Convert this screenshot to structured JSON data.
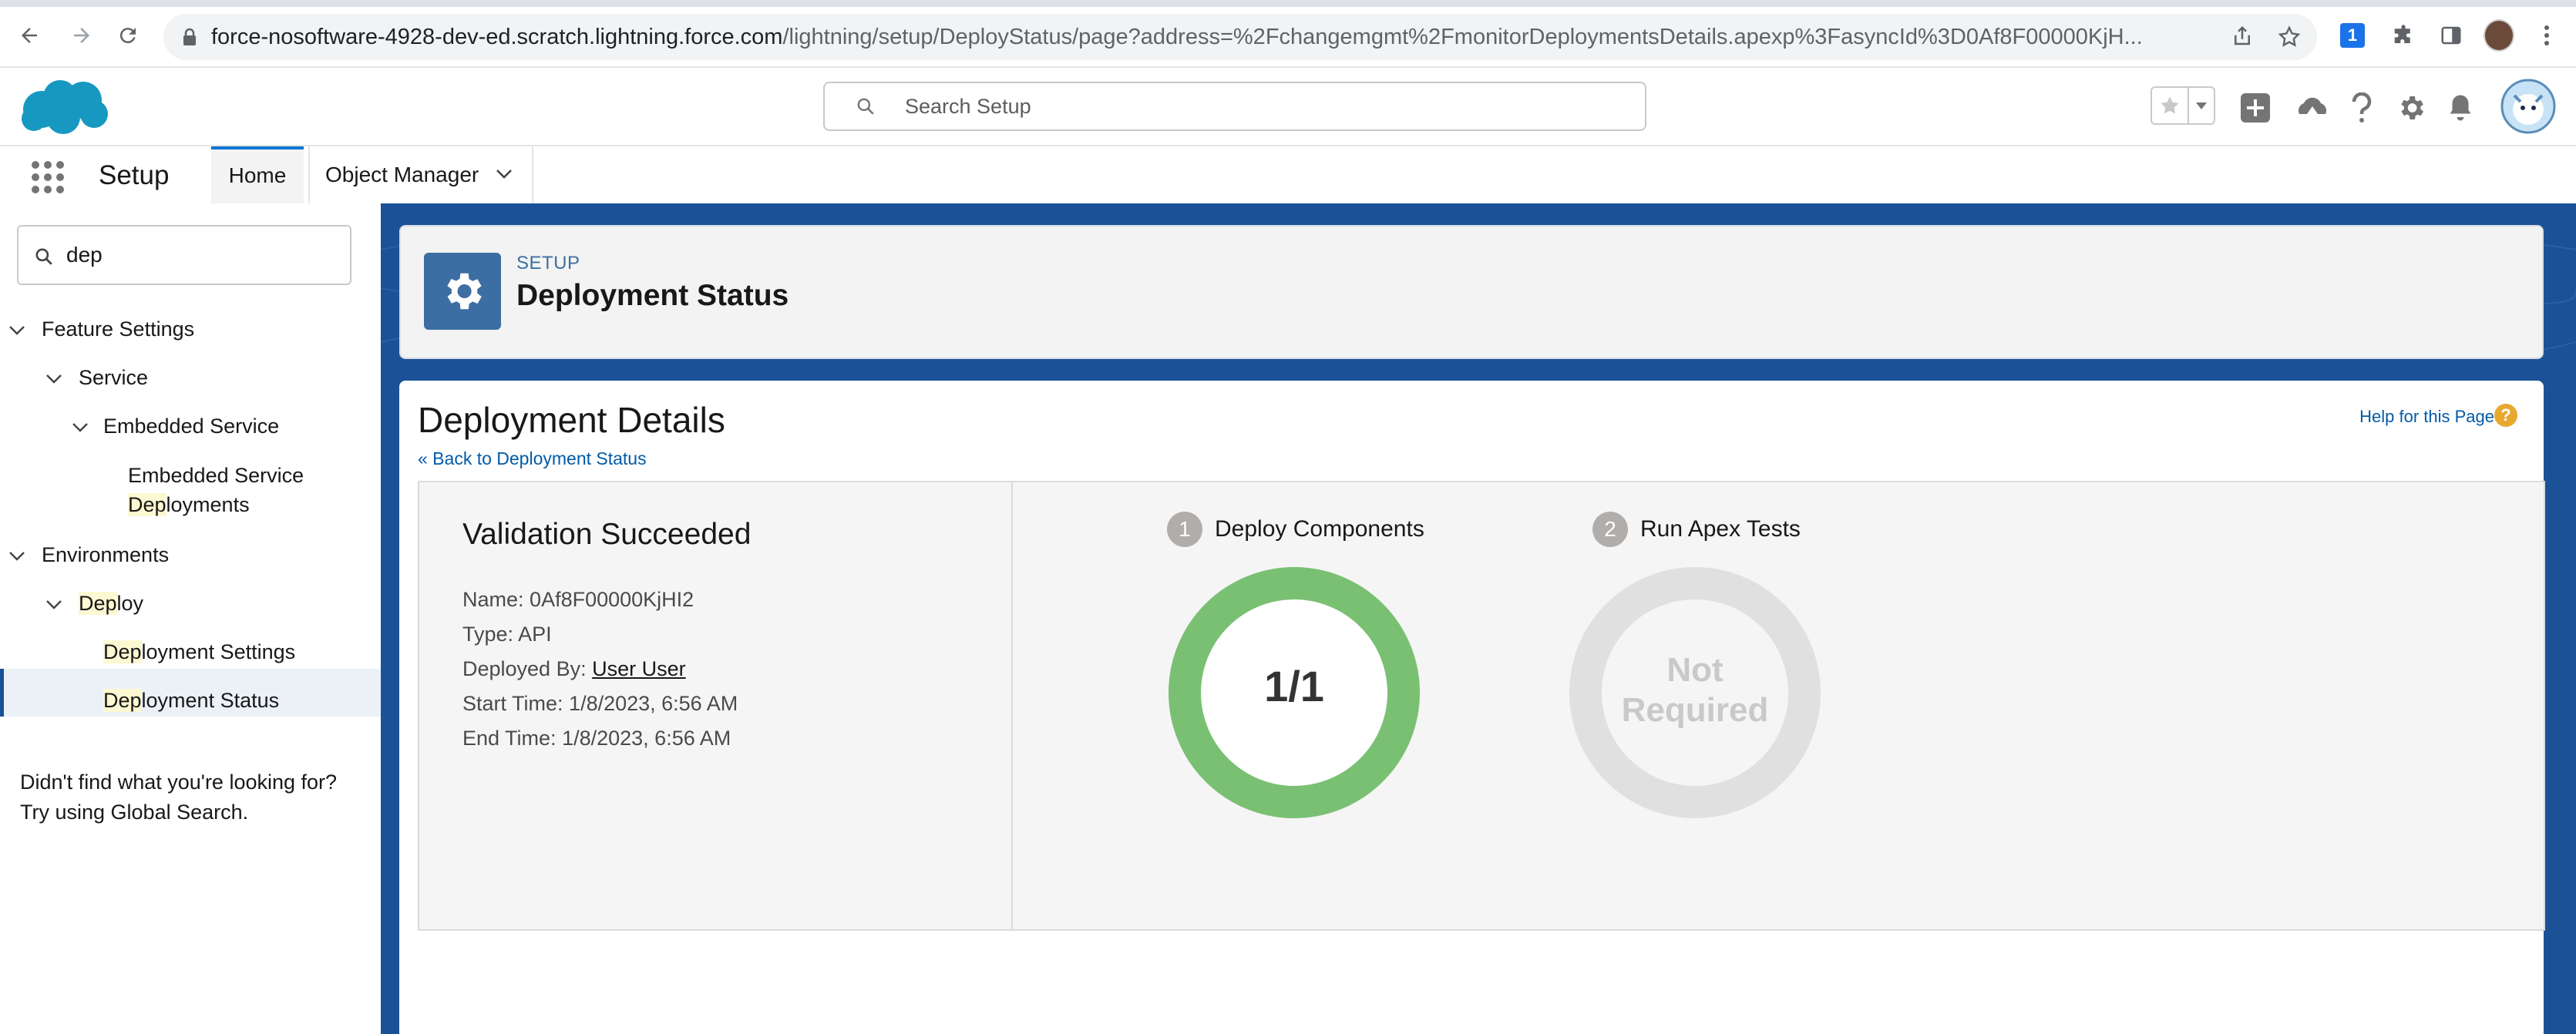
{
  "browser": {
    "url_host": "force-nosoftware-4928-dev-ed.scratch.lightning.force.com",
    "url_path": "/lightning/setup/DeployStatus/page?address=%2Fchangemgmt%2FmonitorDeploymentsDetails.apexp%3FasyncId%3D0Af8F00000KjH..."
  },
  "header": {
    "search_placeholder": "Search Setup"
  },
  "app_nav": {
    "app_name": "Setup",
    "tabs": [
      {
        "label": "Home",
        "active": true
      },
      {
        "label": "Object Manager",
        "active": false
      }
    ]
  },
  "sidebar": {
    "quick_find_value": "dep",
    "tree": [
      {
        "label": "Feature Settings",
        "level": 0
      },
      {
        "label": "Service",
        "level": 1
      },
      {
        "label": "Embedded Service",
        "level": 2
      },
      {
        "label_line1": "Embedded Service",
        "label_line2_hl": "Dep",
        "label_line2_rest": "loyments",
        "level": 3
      },
      {
        "label": "Environments",
        "level": 0
      },
      {
        "label_hl": "Dep",
        "label_rest": "loy",
        "level": 1
      },
      {
        "label_hl": "Dep",
        "label_rest": "loyment Settings",
        "level": 2
      },
      {
        "label_hl": "Dep",
        "label_rest": "loyment Status",
        "level": 2,
        "selected": true
      }
    ],
    "not_found_line1": "Didn't find what you're looking for?",
    "not_found_line2": "Try using Global Search."
  },
  "page_header": {
    "eyebrow": "SETUP",
    "title": "Deployment Status"
  },
  "details": {
    "title": "Deployment Details",
    "back_link": "« Back to Deployment Status",
    "help_link": "Help for this Page",
    "help_icon": "?",
    "status_title": "Validation Succeeded",
    "name_label": "Name:",
    "name_value": "0Af8F00000KjHI2",
    "type_label": "Type:",
    "type_value": "API",
    "deployed_by_label": "Deployed By:",
    "deployed_by_value": "User User",
    "start_label": "Start Time:",
    "start_value": "1/8/2023, 6:56 AM",
    "end_label": "End Time:",
    "end_value": "1/8/2023, 6:56 AM"
  },
  "steps": [
    {
      "number": "1",
      "label": "Deploy Components",
      "center_text": "1/1",
      "progress": 1.0,
      "color": "#7ac073"
    },
    {
      "number": "2",
      "label": "Run Apex Tests",
      "center_line1": "Not",
      "center_line2": "Required",
      "progress": 0,
      "color": "#e0e0e0"
    }
  ],
  "colors": {
    "brand_blue": "#1b5297",
    "link_blue": "#015ba7",
    "success_green": "#7ac073",
    "highlight_yellow": "#fcf8d1"
  }
}
